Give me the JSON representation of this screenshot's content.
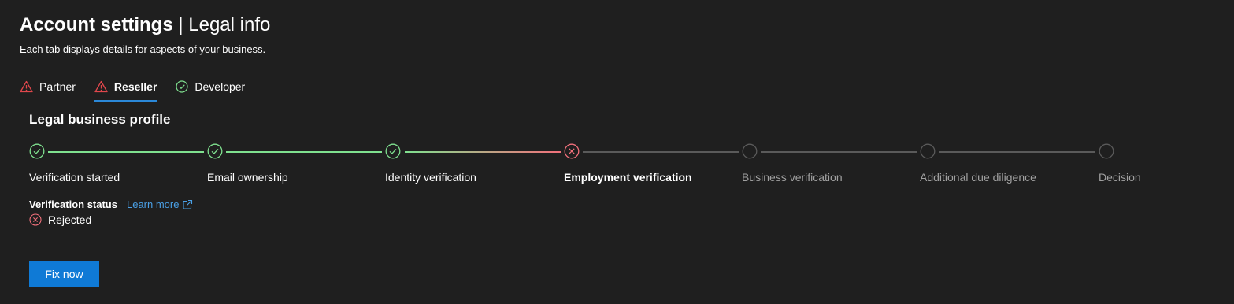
{
  "header": {
    "title_strong": "Account settings",
    "title_separator": " | ",
    "title_light": "Legal info",
    "subtitle": "Each tab displays details for aspects of your business."
  },
  "tabs": [
    {
      "label": "Partner",
      "status": "warning",
      "active": false
    },
    {
      "label": "Reseller",
      "status": "warning",
      "active": true
    },
    {
      "label": "Developer",
      "status": "ok",
      "active": false
    }
  ],
  "profile": {
    "title": "Legal business profile",
    "steps": [
      {
        "label": "Verification started",
        "state": "done"
      },
      {
        "label": "Email ownership",
        "state": "done"
      },
      {
        "label": "Identity verification",
        "state": "done"
      },
      {
        "label": "Employment verification",
        "state": "rejected"
      },
      {
        "label": "Business verification",
        "state": "pending"
      },
      {
        "label": "Additional due diligence",
        "state": "pending"
      },
      {
        "label": "Decision",
        "state": "pending"
      }
    ]
  },
  "status": {
    "label": "Verification status",
    "learn_more": "Learn more",
    "value": "Rejected"
  },
  "actions": {
    "fix_label": "Fix now"
  },
  "colors": {
    "background": "#1f1f1f",
    "success": "#7fe08f",
    "error": "#f1707b",
    "pending": "#5a5a5a",
    "accent": "#0f7ad6",
    "link": "#4aa0e6",
    "warning": "#e0474c"
  }
}
